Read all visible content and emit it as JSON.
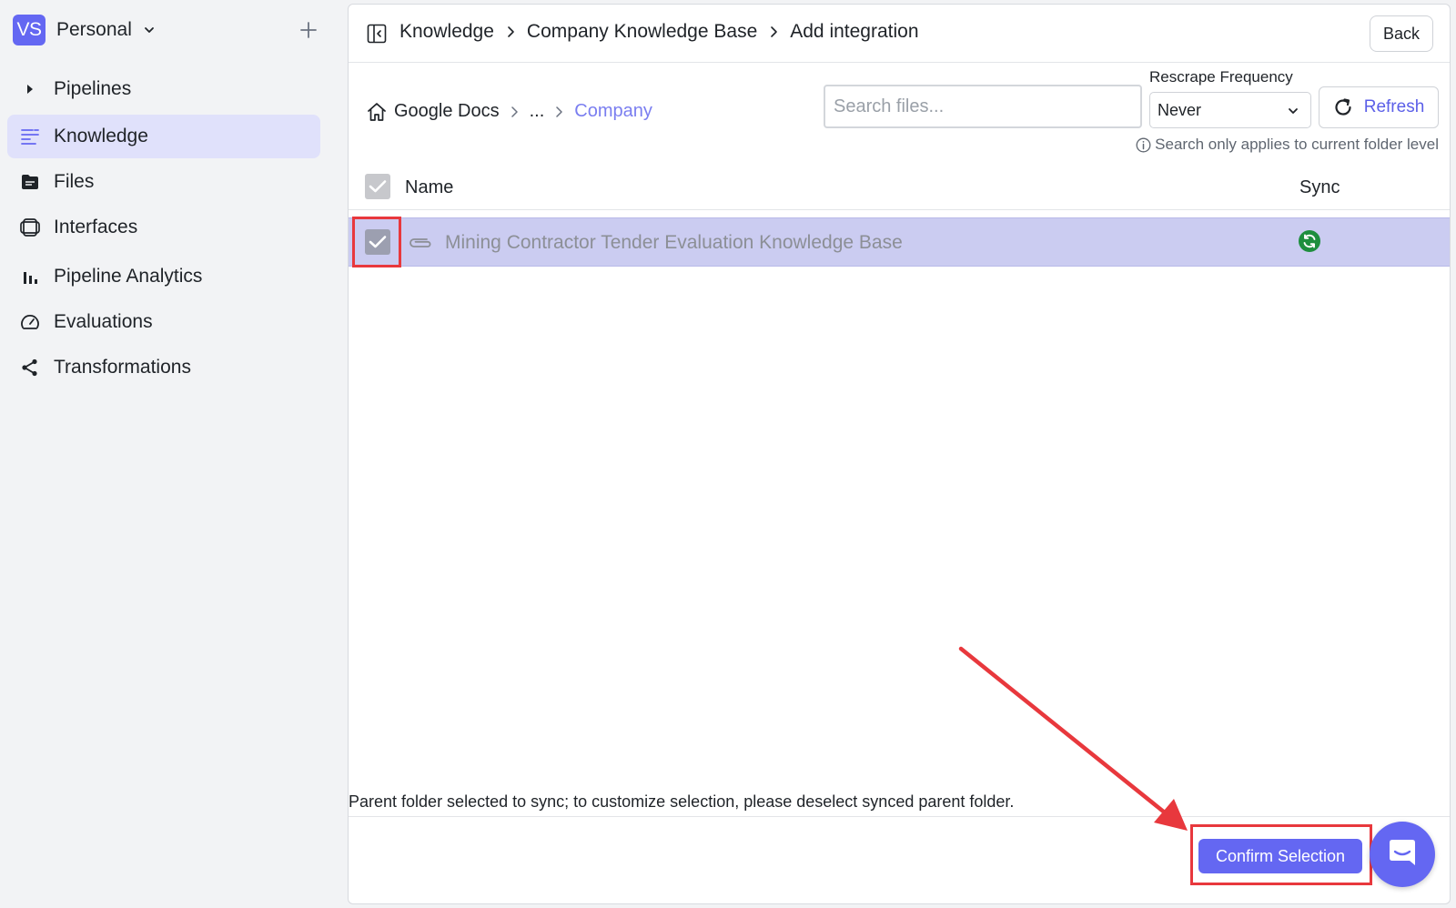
{
  "workspace": {
    "avatar": "VS",
    "name": "Personal"
  },
  "sidebar": {
    "items": [
      {
        "label": "Pipelines",
        "icon": "caret-right-icon",
        "active": false
      },
      {
        "label": "Knowledge",
        "icon": "knowledge-icon",
        "active": true
      },
      {
        "label": "Files",
        "icon": "file-folder-icon",
        "active": false
      },
      {
        "label": "Interfaces",
        "icon": "interfaces-icon",
        "active": false
      },
      {
        "label": "Pipeline Analytics",
        "icon": "bar-chart-icon",
        "active": false
      },
      {
        "label": "Evaluations",
        "icon": "gauge-icon",
        "active": false
      },
      {
        "label": "Transformations",
        "icon": "share-icon",
        "active": false
      }
    ]
  },
  "header": {
    "breadcrumbs": [
      "Knowledge",
      "Company Knowledge Base",
      "Add integration"
    ],
    "back_label": "Back"
  },
  "browser": {
    "path": [
      "Google Docs",
      "...",
      "Company"
    ],
    "search_placeholder": "Search files...",
    "rescrape_label": "Rescrape Frequency",
    "rescrape_value": "Never",
    "refresh_label": "Refresh",
    "search_hint": "Search only applies to current folder level"
  },
  "table": {
    "columns": [
      "Name",
      "Sync"
    ],
    "rows": [
      {
        "name": "Mining Contractor Tender Evaluation Knowledge Base",
        "checked": true,
        "synced": true
      }
    ]
  },
  "footer": {
    "notice": "Parent folder selected to sync; to customize selection, please deselect synced parent folder.",
    "confirm_label": "Confirm Selection"
  },
  "colors": {
    "accent": "#6467f2",
    "highlight": "#e8383d",
    "selected_row": "#cbccf1",
    "sync_green": "#1e8e3e"
  }
}
